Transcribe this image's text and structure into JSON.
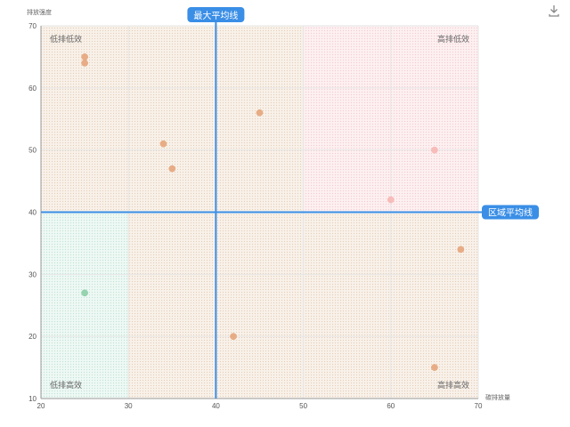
{
  "toolbar": {
    "download_icon": "download-icon"
  },
  "chart_data": {
    "type": "scatter",
    "title": "",
    "xlabel": "碳排放量",
    "ylabel": "排放强度",
    "xlim": [
      20,
      70
    ],
    "ylim": [
      10,
      70
    ],
    "xticks": [
      20,
      30,
      40,
      50,
      60,
      70
    ],
    "yticks": [
      10,
      20,
      30,
      40,
      50,
      60,
      70
    ],
    "grid": true,
    "x_marker": {
      "value": 40,
      "label": "最大平均线",
      "color": "#3a8ee6"
    },
    "y_marker": {
      "value": 40,
      "label": "区域平均线",
      "color": "#3a8ee6"
    },
    "regions": [
      {
        "name": "低排低效",
        "x_range": [
          20,
          50
        ],
        "y_range": [
          40,
          70
        ],
        "color": "#f5ede4",
        "label_pos": "top-left"
      },
      {
        "name": "高排低效",
        "x_range": [
          50,
          70
        ],
        "y_range": [
          40,
          70
        ],
        "color": "#fde9eb",
        "label_pos": "top-right"
      },
      {
        "name": "低排高效",
        "x_range": [
          20,
          30
        ],
        "y_range": [
          10,
          40
        ],
        "color": "#e5f5ef",
        "label_pos": "bottom-left"
      },
      {
        "name": "高排高效",
        "x_range": [
          30,
          70
        ],
        "y_range": [
          10,
          40
        ],
        "color": "#f5ede4",
        "label_pos": "bottom-right"
      }
    ],
    "points": [
      {
        "x": 25,
        "y": 65,
        "color": "#e5a57b"
      },
      {
        "x": 25,
        "y": 64,
        "color": "#e5a57b"
      },
      {
        "x": 45,
        "y": 56,
        "color": "#e5a57b"
      },
      {
        "x": 34,
        "y": 51,
        "color": "#e5a57b"
      },
      {
        "x": 35,
        "y": 47,
        "color": "#e5a57b"
      },
      {
        "x": 65,
        "y": 50,
        "color": "#f7b7b4"
      },
      {
        "x": 60,
        "y": 42,
        "color": "#f7b7b4"
      },
      {
        "x": 68,
        "y": 34,
        "color": "#e5a57b"
      },
      {
        "x": 25,
        "y": 27,
        "color": "#8ccfa9"
      },
      {
        "x": 42,
        "y": 20,
        "color": "#e5a57b"
      },
      {
        "x": 65,
        "y": 15,
        "color": "#e5a57b"
      }
    ]
  }
}
